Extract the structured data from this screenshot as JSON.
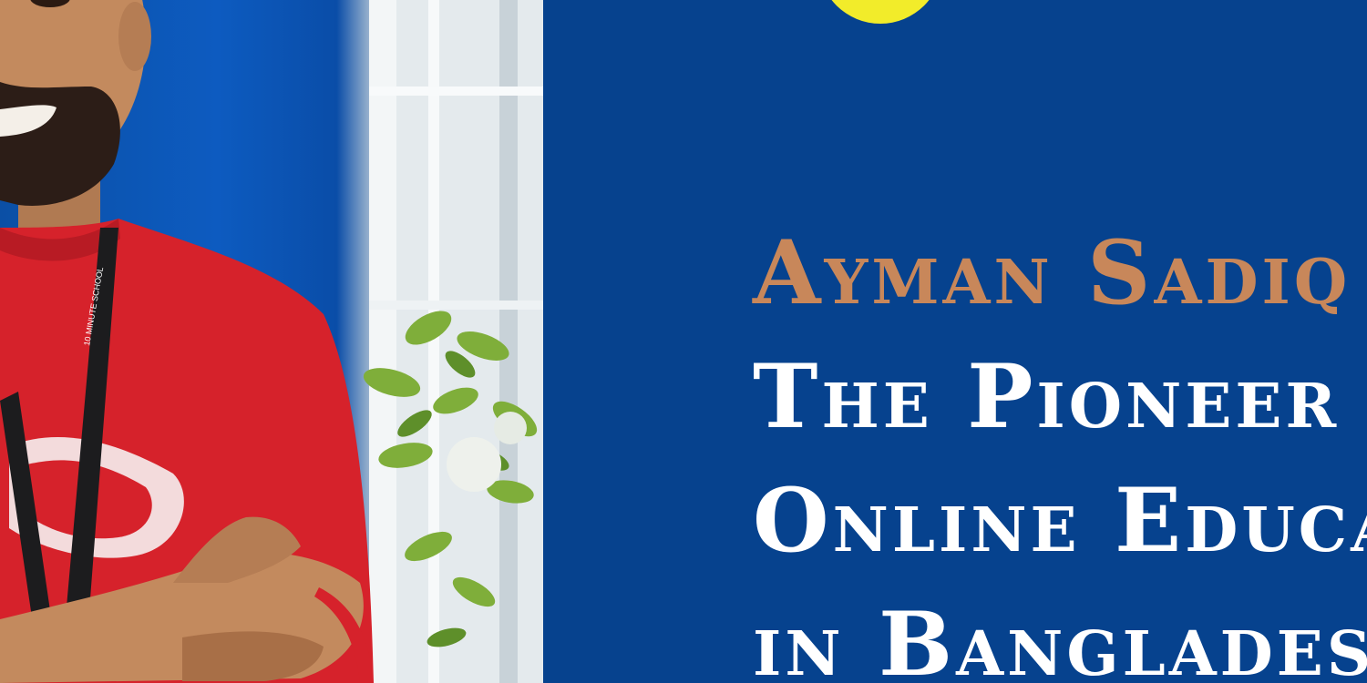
{
  "hero": {
    "name_line": "Ayman Sadiq",
    "tagline_lines": [
      "The Pioneer of",
      "Online Education",
      "in Bangladesh"
    ]
  },
  "photo": {
    "lanyard_text": "10 MINUTE SCHOOL"
  },
  "colors": {
    "panel_background": "#06428e",
    "name_color": "#c8875a",
    "tagline_color": "#ffffff",
    "sun_color": "#f2ec2a",
    "shirt_color": "#d6222b"
  }
}
